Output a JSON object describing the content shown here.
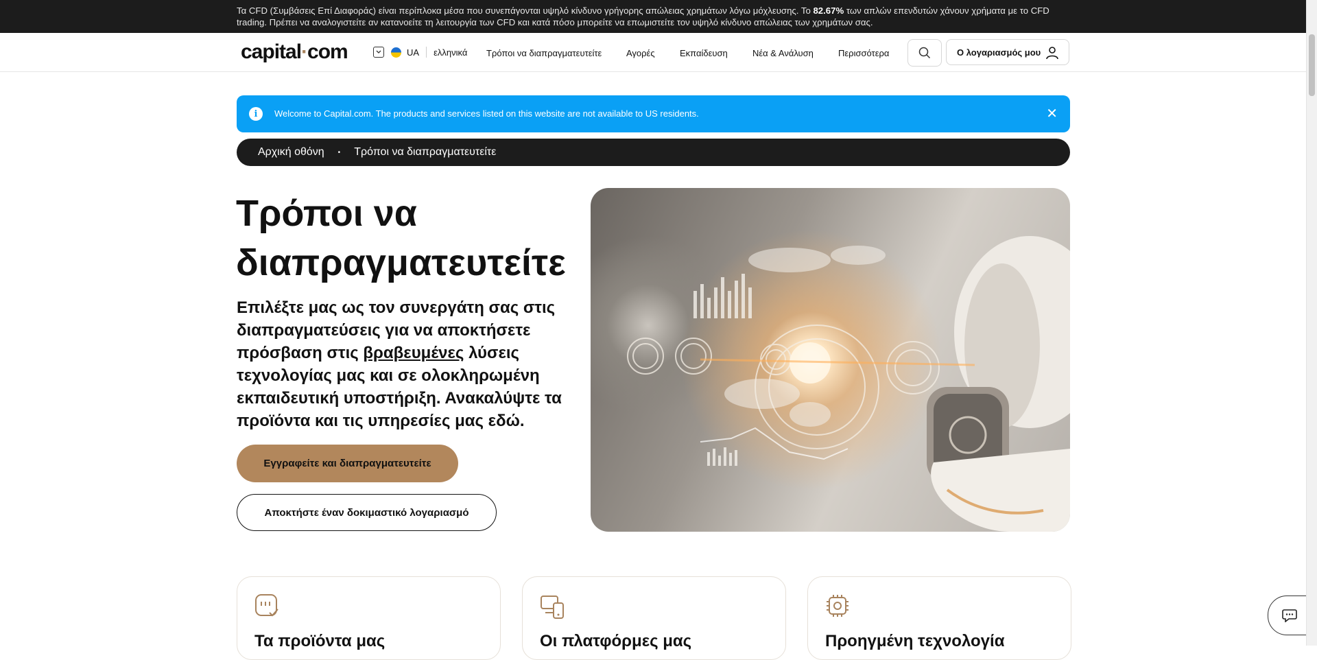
{
  "risk": {
    "before": "Τα CFD (Συμβάσεις Επί Διαφοράς) είναι περίπλοκα μέσα που συνεπάγονται υψηλό κίνδυνο γρήγορης απώλειας χρημάτων λόγω μόχλευσης. Το ",
    "percent": "82.67%",
    "after": " των απλών επενδυτών χάνουν χρήματα με το CFD trading. Πρέπει να αναλογιστείτε αν κατανοείτε τη λειτουργία των CFD και κατά πόσο μπορείτε να επωμιστείτε τον υψηλό κίνδυνο απώλειας των χρημάτων σας."
  },
  "header": {
    "logo_left": "capital",
    "logo_dot": "·",
    "logo_right": "com",
    "country": "UA",
    "language": "ελληνικά",
    "nav": [
      "Τρόποι να διαπραγματευτείτε",
      "Αγορές",
      "Εκπαίδευση",
      "Νέα & Ανάλυση",
      "Περισσότερα"
    ],
    "account_label": "Ο λογαριασμός μου"
  },
  "notice": {
    "text": "Welcome to Capital.com. The products and services listed on this website are not available to US residents.",
    "info_glyph": "i",
    "close_glyph": "✕"
  },
  "breadcrumb": {
    "home": "Αρχική οθόνη",
    "separator": "•",
    "current": "Τρόποι να διαπραγματευτείτε"
  },
  "hero": {
    "title": "Τρόποι να διαπραγματευτείτε",
    "sub_before": "Επιλέξτε μας ως τον συνεργάτη σας στις διαπραγματεύσεις για να αποκτήσετε πρόσβαση στις ",
    "sub_link": "βραβευμένες",
    "sub_after": " λύσεις τεχνολογίας μας και σε ολοκληρωμένη εκπαιδευτική υποστήριξη. Ανακαλύψτε τα προϊόντα και τις υπηρεσίες μας εδώ.",
    "primary_button": "Εγγραφείτε και διαπραγματευτείτε",
    "secondary_button": "Αποκτήστε έναν δοκιμαστικό λογαριασμό"
  },
  "cards": [
    {
      "title": "Τα προϊόντα μας",
      "icon": "products-icon"
    },
    {
      "title": "Οι πλατφόρμες μας",
      "icon": "platforms-icon"
    },
    {
      "title": "Προηγμένη τεχνολογία",
      "icon": "technology-icon"
    }
  ],
  "colors": {
    "accent": "#b2875c",
    "notice_blue": "#0aa0f5",
    "dark": "#1c1c1c"
  }
}
